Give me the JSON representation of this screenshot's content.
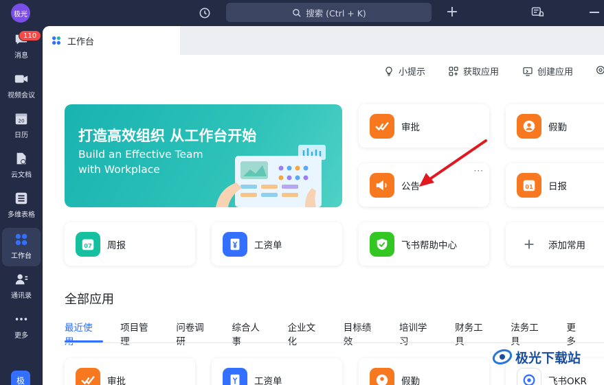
{
  "app": {
    "avatar_text": "极光",
    "search_placeholder": "搜索 (Ctrl + K)",
    "bottom_avatar": "极"
  },
  "sidebar": {
    "badge": "110",
    "items": [
      {
        "label": "消息",
        "icon": "chat-icon"
      },
      {
        "label": "视频会议",
        "icon": "video-icon"
      },
      {
        "label": "日历",
        "icon": "calendar-icon"
      },
      {
        "label": "云文档",
        "icon": "cloud-doc-icon"
      },
      {
        "label": "多维表格",
        "icon": "table-icon"
      },
      {
        "label": "工作台",
        "icon": "workplace-icon"
      },
      {
        "label": "通讯录",
        "icon": "contacts-icon"
      },
      {
        "label": "更多",
        "icon": "more-icon"
      }
    ]
  },
  "tab": {
    "label": "工作台"
  },
  "toolbar": {
    "tips": "小提示",
    "get_apps": "获取应用",
    "create_app": "创建应用"
  },
  "banner": {
    "title": "打造高效组织 从工作台开始",
    "subtitle_line1": "Build an Effective Team",
    "subtitle_line2": "with Workplace"
  },
  "common_apps": [
    {
      "label": "审批",
      "icon": "approval-icon",
      "color": "#f7781f"
    },
    {
      "label": "假勤",
      "icon": "leave-icon",
      "color": "#f7781f"
    },
    {
      "label": "公告",
      "icon": "announcement-icon",
      "color": "#f7781f"
    },
    {
      "label": "日报",
      "icon": "daily-report-icon",
      "color": "#f7781f"
    },
    {
      "label": "周报",
      "icon": "weekly-report-icon",
      "color": "#14c0a0"
    },
    {
      "label": "工资单",
      "icon": "payslip-icon",
      "color": "#3370ff"
    },
    {
      "label": "飞书帮助中心",
      "icon": "help-center-icon",
      "color": "#34c724"
    },
    {
      "label": "添加常用",
      "icon": "add-icon",
      "color": "#646a73"
    }
  ],
  "daily_day": "01",
  "weekly_day": "07",
  "section_title": "全部应用",
  "category_tabs": [
    "最近使用",
    "项目管理",
    "问卷调研",
    "综合人事",
    "企业文化",
    "目标绩效",
    "培训学习",
    "财务工具",
    "法务工具",
    "更多"
  ],
  "recent_apps": [
    {
      "label": "审批"
    },
    {
      "label": "工资单"
    },
    {
      "label": "假勤"
    },
    {
      "label": "飞书OKR"
    }
  ],
  "watermark": "极光下载站",
  "colors": {
    "accent": "#3370ff",
    "sidebar_bg": "#232b45",
    "banner": "#1fb8b3",
    "arrow": "#e1191e"
  }
}
